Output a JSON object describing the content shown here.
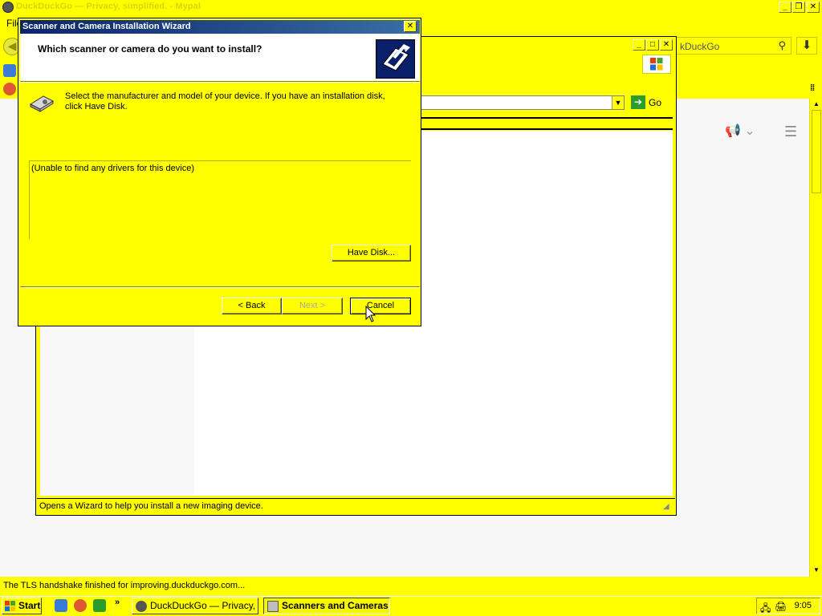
{
  "browser": {
    "title": "DuckDuckGo — Privacy, simplified. - Mypal",
    "menu_file": "File",
    "search_text": "kDuckGo",
    "status_text": "The TLS handshake finished for improving.duckduckgo.com..."
  },
  "scan_window": {
    "go_label": "Go",
    "status_text": "Opens a Wizard to help you install a new imaging device."
  },
  "wizard": {
    "title": "Scanner and Camera Installation Wizard",
    "heading": "Which scanner or camera do you want to install?",
    "description": "Select the manufacturer and model of your device. If you have an installation disk, click Have Disk.",
    "list_message": "(Unable to find any drivers for this device)",
    "have_disk_label": "Have Disk...",
    "back_label": "< Back",
    "next_label": "Next >",
    "cancel_label": "Cancel"
  },
  "taskbar": {
    "start_label": "Start",
    "quicklaunch_more": "»",
    "tasks": [
      {
        "label": "DuckDuckGo — Privacy, ...",
        "active": false
      },
      {
        "label": "Scanners and Cameras",
        "active": true
      }
    ],
    "clock": "9:05"
  },
  "colors": {
    "theme_face": "#ffff00",
    "title_active": "#0a246a",
    "go_green": "#2c9c2c"
  }
}
